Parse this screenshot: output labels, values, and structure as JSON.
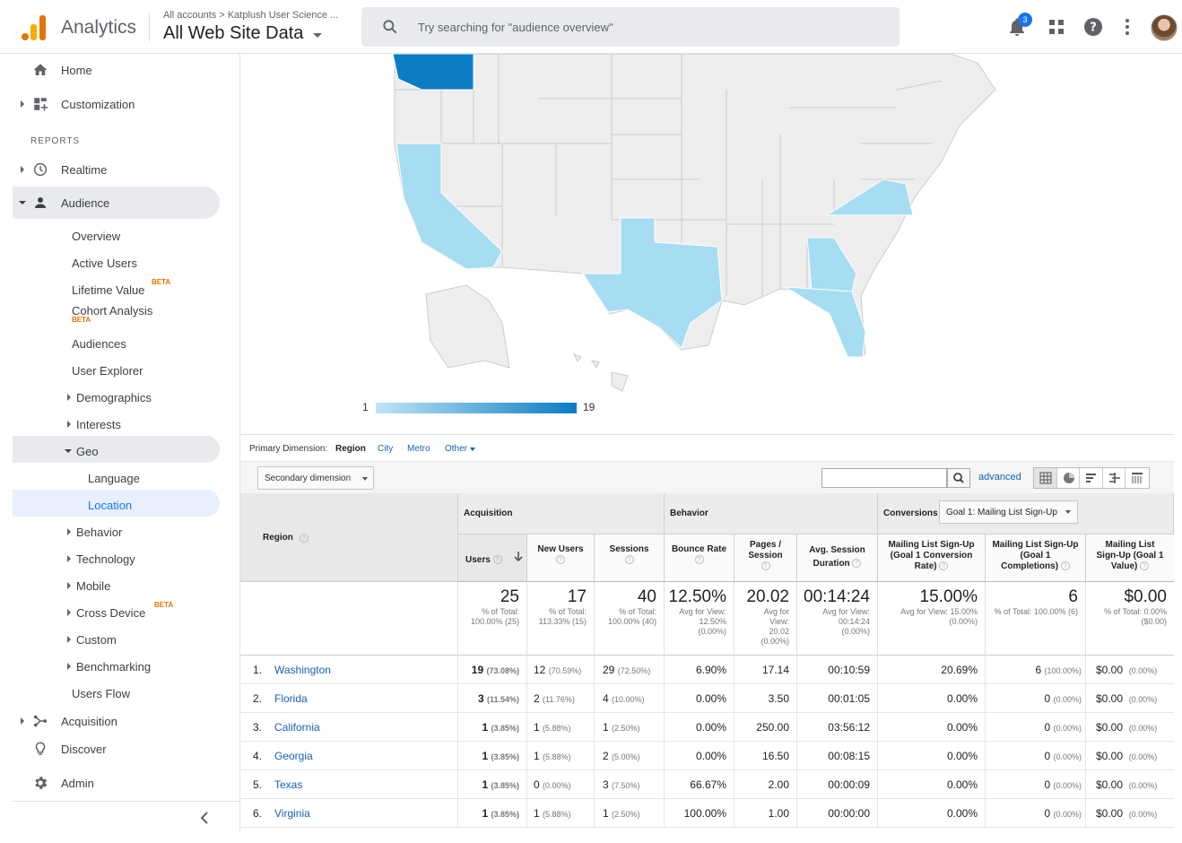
{
  "header": {
    "app_name": "Analytics",
    "breadcrumb": "All accounts > Katplush User Science ...",
    "view": "All Web Site Data",
    "search_placeholder": "Try searching for \"audience overview\"",
    "notification_count": "3"
  },
  "sidebar": {
    "home": "Home",
    "customization": "Customization",
    "reports_header": "REPORTS",
    "realtime": "Realtime",
    "audience": "Audience",
    "audience_items": {
      "overview": "Overview",
      "active_users": "Active Users",
      "lifetime_value": "Lifetime Value",
      "cohort_analysis": "Cohort Analysis",
      "audiences": "Audiences",
      "user_explorer": "User Explorer",
      "demographics": "Demographics",
      "interests": "Interests",
      "geo": "Geo",
      "language": "Language",
      "location": "Location",
      "behavior": "Behavior",
      "technology": "Technology",
      "mobile": "Mobile",
      "cross_device": "Cross Device",
      "custom": "Custom",
      "benchmarking": "Benchmarking",
      "users_flow": "Users Flow"
    },
    "beta": "BETA",
    "acquisition": "Acquisition",
    "discover": "Discover",
    "admin": "Admin"
  },
  "map": {
    "legend_min": "1",
    "legend_max": "19",
    "colors": {
      "low": "#bfe4f6",
      "high": "#0b7cc3",
      "empty": "#eeeeee"
    }
  },
  "dimensions": {
    "label": "Primary Dimension:",
    "region": "Region",
    "city": "City",
    "metro": "Metro",
    "other": "Other"
  },
  "toolbar": {
    "secondary_dimension": "Secondary dimension",
    "advanced": "advanced"
  },
  "table": {
    "region_header": "Region",
    "groups": {
      "acquisition": "Acquisition",
      "behavior": "Behavior",
      "conversions": "Conversions"
    },
    "goal_select": "Goal 1: Mailing List Sign-Up",
    "columns": {
      "users": "Users",
      "new_users": "New Users",
      "sessions": "Sessions",
      "bounce_rate": "Bounce Rate",
      "pages_session": "Pages / Session",
      "avg_duration": "Avg. Session Duration",
      "conv_rate": "Mailing List Sign-Up (Goal 1 Conversion Rate)",
      "completions": "Mailing List Sign-Up (Goal 1 Completions)",
      "value": "Mailing List Sign-Up (Goal 1 Value)"
    },
    "totals": {
      "users": {
        "big": "25",
        "sub": "% of Total: 100.00% (25)"
      },
      "new_users": {
        "big": "17",
        "sub": "% of Total: 113.33% (15)"
      },
      "sessions": {
        "big": "40",
        "sub": "% of Total: 100.00% (40)"
      },
      "bounce_rate": {
        "big": "12.50%",
        "sub": "Avg for View: 12.50% (0.00%)"
      },
      "pages_session": {
        "big": "20.02",
        "sub": "Avg for View: 20.02 (0.00%)"
      },
      "avg_duration": {
        "big": "00:14:24",
        "sub": "Avg for View: 00:14:24 (0.00%)"
      },
      "conv_rate": {
        "big": "15.00%",
        "sub": "Avg for View: 15.00% (0.00%)"
      },
      "completions": {
        "big": "6",
        "sub": "% of Total: 100.00% (6)"
      },
      "value": {
        "big": "$0.00",
        "sub": "% of Total: 0.00% ($0.00)"
      }
    },
    "rows": [
      {
        "idx": "1.",
        "region": "Washington",
        "users": "19",
        "users_pct": "(73.08%)",
        "new_users": "12",
        "new_users_pct": "(70.59%)",
        "sessions": "29",
        "sessions_pct": "(72.50%)",
        "bounce": "6.90%",
        "pages": "17.14",
        "duration": "00:10:59",
        "conv": "20.69%",
        "comp": "6",
        "comp_pct": "(100.00%)",
        "value": "$0.00",
        "value_pct": "(0.00%)"
      },
      {
        "idx": "2.",
        "region": "Florida",
        "users": "3",
        "users_pct": "(11.54%)",
        "new_users": "2",
        "new_users_pct": "(11.76%)",
        "sessions": "4",
        "sessions_pct": "(10.00%)",
        "bounce": "0.00%",
        "pages": "3.50",
        "duration": "00:01:05",
        "conv": "0.00%",
        "comp": "0",
        "comp_pct": "(0.00%)",
        "value": "$0.00",
        "value_pct": "(0.00%)"
      },
      {
        "idx": "3.",
        "region": "California",
        "users": "1",
        "users_pct": "(3.85%)",
        "new_users": "1",
        "new_users_pct": "(5.88%)",
        "sessions": "1",
        "sessions_pct": "(2.50%)",
        "bounce": "0.00%",
        "pages": "250.00",
        "duration": "03:56:12",
        "conv": "0.00%",
        "comp": "0",
        "comp_pct": "(0.00%)",
        "value": "$0.00",
        "value_pct": "(0.00%)"
      },
      {
        "idx": "4.",
        "region": "Georgia",
        "users": "1",
        "users_pct": "(3.85%)",
        "new_users": "1",
        "new_users_pct": "(5.88%)",
        "sessions": "2",
        "sessions_pct": "(5.00%)",
        "bounce": "0.00%",
        "pages": "16.50",
        "duration": "00:08:15",
        "conv": "0.00%",
        "comp": "0",
        "comp_pct": "(0.00%)",
        "value": "$0.00",
        "value_pct": "(0.00%)"
      },
      {
        "idx": "5.",
        "region": "Texas",
        "users": "1",
        "users_pct": "(3.85%)",
        "new_users": "0",
        "new_users_pct": "(0.00%)",
        "sessions": "3",
        "sessions_pct": "(7.50%)",
        "bounce": "66.67%",
        "pages": "2.00",
        "duration": "00:00:09",
        "conv": "0.00%",
        "comp": "0",
        "comp_pct": "(0.00%)",
        "value": "$0.00",
        "value_pct": "(0.00%)"
      },
      {
        "idx": "6.",
        "region": "Virginia",
        "users": "1",
        "users_pct": "(3.85%)",
        "new_users": "1",
        "new_users_pct": "(5.88%)",
        "sessions": "1",
        "sessions_pct": "(2.50%)",
        "bounce": "100.00%",
        "pages": "1.00",
        "duration": "00:00:00",
        "conv": "0.00%",
        "comp": "0",
        "comp_pct": "(0.00%)",
        "value": "$0.00",
        "value_pct": "(0.00%)"
      }
    ]
  }
}
